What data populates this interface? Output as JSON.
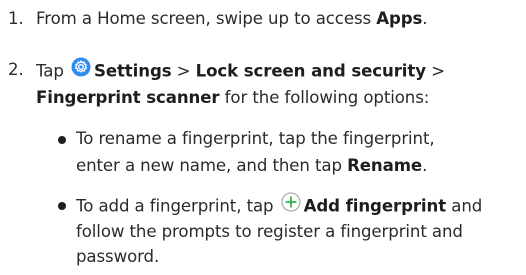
{
  "steps": [
    {
      "number": "1.",
      "text_before": "From a Home screen, swipe up to access ",
      "bold": "Apps",
      "text_after": "."
    },
    {
      "number": "2.",
      "line1_before": "Tap ",
      "icon": "settings-gear-icon",
      "line1_bold1": "Settings",
      "line1_sep1": " > ",
      "line1_bold2": "Lock screen and security",
      "line1_sep2": " >",
      "line2_bold": "Fingerprint scanner",
      "line2_text": " for the following options:"
    }
  ],
  "bullets": [
    {
      "line1": "To rename a fingerprint, tap the fingerprint,",
      "line2_before": "enter a new name, and then tap ",
      "line2_bold": "Rename",
      "line2_after": "."
    },
    {
      "line1_before": "To add a fingerprint, tap ",
      "icon": "add-circle-icon",
      "line1_bold": "Add fingerprint",
      "line1_after": " and",
      "line2": "follow the prompts to register a fingerprint and",
      "line3": "password."
    }
  ],
  "colors": {
    "icon_accent": "#2f8cf0",
    "add_icon_accent": "#2fb64a",
    "text": "#2b2b2b"
  }
}
